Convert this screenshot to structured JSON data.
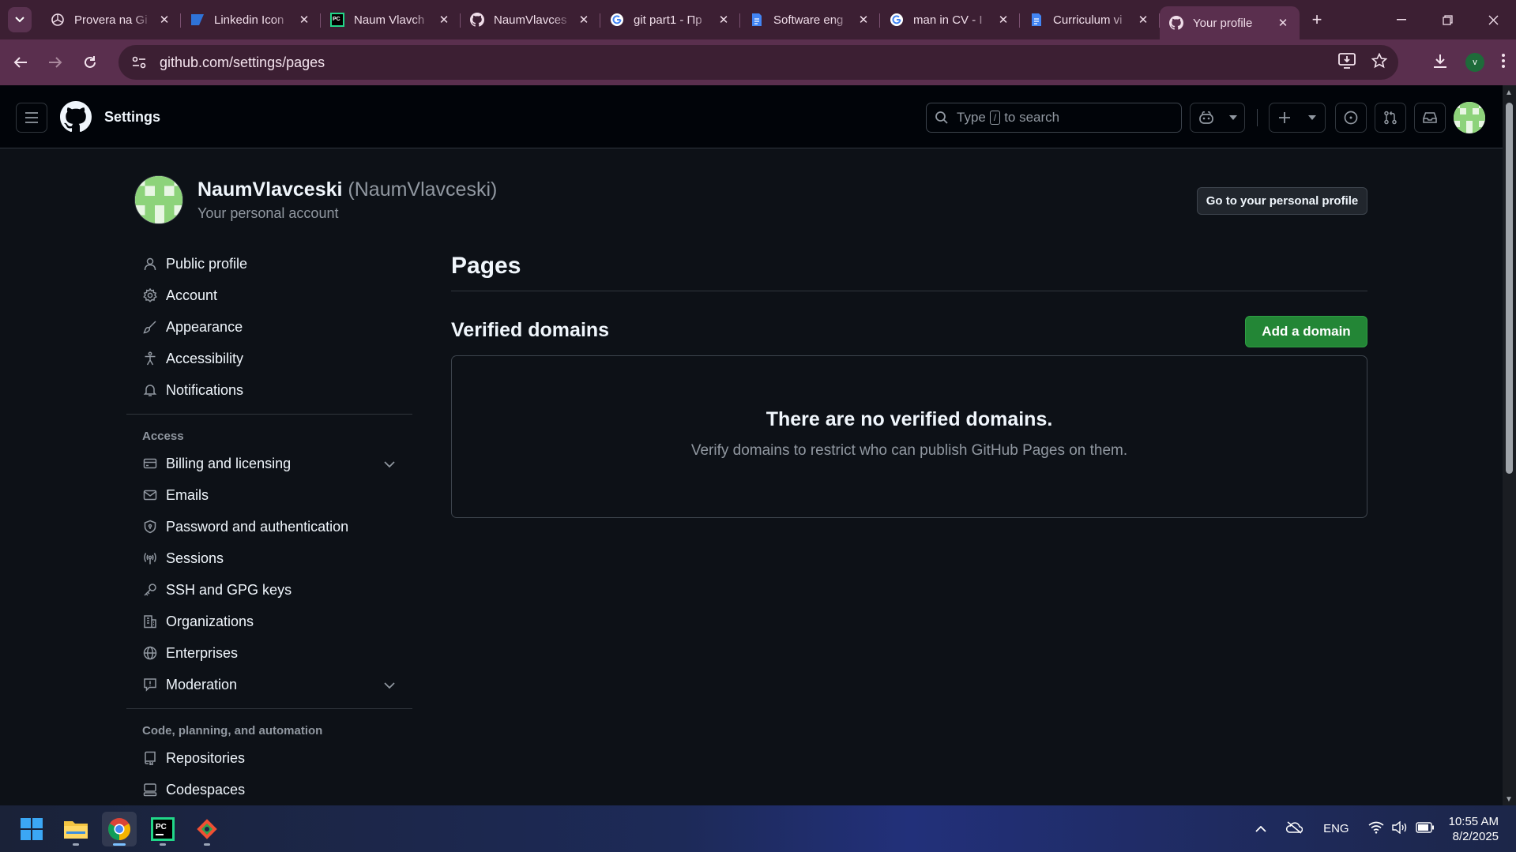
{
  "browser": {
    "tabs": [
      {
        "label": "Provera na Gi",
        "favicon": "openai-icon"
      },
      {
        "label": "Linkedin Icon",
        "favicon": "linkedin-icon"
      },
      {
        "label": "Naum Vlavch",
        "favicon": "pycharm-icon"
      },
      {
        "label": "NaumVlavces",
        "favicon": "github-icon"
      },
      {
        "label": "git part1 - Пр",
        "favicon": "google-icon"
      },
      {
        "label": "Software eng",
        "favicon": "docs-icon"
      },
      {
        "label": "man in CV - I",
        "favicon": "google-icon"
      },
      {
        "label": "Curriculum vi",
        "favicon": "docs-icon"
      },
      {
        "label": "Your profile",
        "favicon": "github-icon",
        "active": true
      }
    ],
    "url": "github.com/settings/pages",
    "profile_initial": "v"
  },
  "header": {
    "title": "Settings",
    "search_prefix": "Type",
    "search_key": "/",
    "search_suffix": "to search"
  },
  "user": {
    "name": "NaumVlavceski",
    "login": "(NaumVlavceski)",
    "subtitle": "Your personal account",
    "profile_button": "Go to your personal profile"
  },
  "sidebar": {
    "group1": [
      {
        "label": "Public profile",
        "icon": "person-icon"
      },
      {
        "label": "Account",
        "icon": "gear-icon"
      },
      {
        "label": "Appearance",
        "icon": "paintbrush-icon"
      },
      {
        "label": "Accessibility",
        "icon": "accessibility-icon"
      },
      {
        "label": "Notifications",
        "icon": "bell-icon"
      }
    ],
    "access_heading": "Access",
    "group2": [
      {
        "label": "Billing and licensing",
        "icon": "credit-card-icon",
        "expandable": true
      },
      {
        "label": "Emails",
        "icon": "mail-icon"
      },
      {
        "label": "Password and authentication",
        "icon": "shield-icon"
      },
      {
        "label": "Sessions",
        "icon": "broadcast-icon"
      },
      {
        "label": "SSH and GPG keys",
        "icon": "key-icon"
      },
      {
        "label": "Organizations",
        "icon": "organization-icon"
      },
      {
        "label": "Enterprises",
        "icon": "globe-icon"
      },
      {
        "label": "Moderation",
        "icon": "report-icon",
        "expandable": true
      }
    ],
    "code_heading": "Code, planning, and automation",
    "group3": [
      {
        "label": "Repositories",
        "icon": "repo-icon"
      },
      {
        "label": "Codespaces",
        "icon": "codespaces-icon"
      }
    ]
  },
  "main": {
    "page_title": "Pages",
    "section_title": "Verified domains",
    "add_button": "Add a domain",
    "blank_title": "There are no verified domains.",
    "blank_description": "Verify domains to restrict who can publish GitHub Pages on them."
  },
  "taskbar": {
    "language": "ENG",
    "time": "10:55 AM",
    "date": "8/2/2025"
  }
}
